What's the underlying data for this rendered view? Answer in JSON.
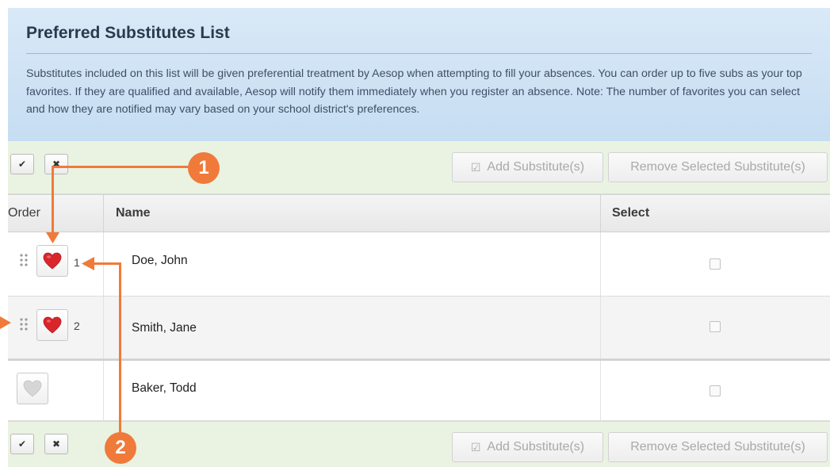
{
  "header": {
    "title": "Preferred Substitutes List",
    "description": "Substitutes included on this list will be given preferential treatment by Aesop when attempting to fill your absences. You can order up to five subs as your top favorites. If they are qualified and available, Aesop will notify them immediately when you register an absence. Note: The number of favorites you can select and how they are notified may vary based on your school district's preferences."
  },
  "toolbar": {
    "check_glyph": "✔",
    "clear_glyph": "✖",
    "add_label": "Add Substitute(s)",
    "remove_label": "Remove Selected Substitute(s)"
  },
  "table": {
    "columns": [
      "Order",
      "Name",
      "Select"
    ],
    "rows": [
      {
        "order": "1",
        "name": "Doe, John",
        "favorite": true
      },
      {
        "order": "2",
        "name": "Smith, Jane",
        "favorite": true
      },
      {
        "order": "",
        "name": "Baker, Todd",
        "favorite": false
      }
    ]
  },
  "callouts": [
    "1",
    "2"
  ],
  "colors": {
    "accent": "#f07a3a",
    "heart_active": "#d9262c",
    "heart_inactive": "#d6d6d6",
    "header_bg": "#c6ddf2",
    "toolbar_bg": "#eaf3e2"
  }
}
